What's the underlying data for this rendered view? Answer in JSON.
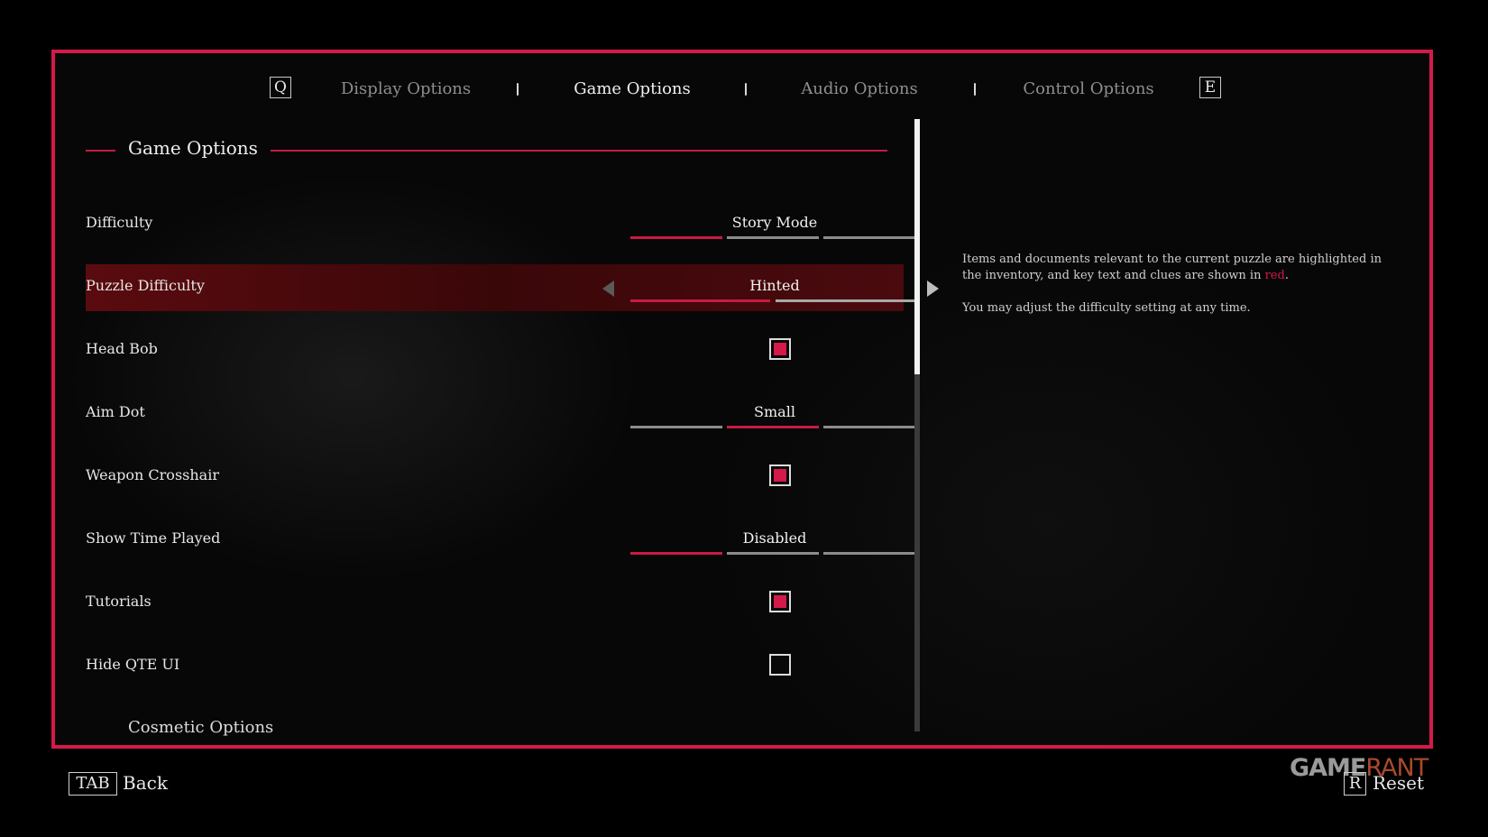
{
  "tabs": {
    "prev_key": "Q",
    "next_key": "E",
    "items": [
      {
        "label": "Display Options",
        "active": false
      },
      {
        "label": "Game Options",
        "active": true
      },
      {
        "label": "Audio Options",
        "active": false
      },
      {
        "label": "Control Options",
        "active": false
      }
    ]
  },
  "section": {
    "title": "Game Options",
    "next_section_title": "Cosmetic Options"
  },
  "settings": [
    {
      "label": "Difficulty",
      "type": "selector",
      "value": "Story Mode",
      "option_index": 1,
      "option_count": 3
    },
    {
      "label": "Puzzle Difficulty",
      "type": "selector",
      "value": "Hinted",
      "option_index": 1,
      "option_count": 2,
      "selected": true
    },
    {
      "label": "Head Bob",
      "type": "checkbox",
      "checked": true
    },
    {
      "label": "Aim Dot",
      "type": "selector",
      "value": "Small",
      "option_index": 2,
      "option_count": 3
    },
    {
      "label": "Weapon Crosshair",
      "type": "checkbox",
      "checked": true
    },
    {
      "label": "Show Time Played",
      "type": "selector",
      "value": "Disabled",
      "option_index": 1,
      "option_count": 3
    },
    {
      "label": "Tutorials",
      "type": "checkbox",
      "checked": true
    },
    {
      "label": "Hide QTE UI",
      "type": "checkbox",
      "checked": false
    }
  ],
  "description": {
    "line1_before": "Items and documents relevant to the current puzzle are highlighted in the inventory, and key text and clues are shown in ",
    "line1_red": "red",
    "line1_after": ".",
    "line2": "You may adjust the difficulty setting at any time."
  },
  "footer": {
    "back_key": "TAB",
    "back_label": "Back",
    "reset_key": "R",
    "reset_label": "Reset"
  },
  "watermark": {
    "part1": "GAME",
    "part2": "RANT"
  },
  "colors": {
    "accent": "#d31a4a",
    "selected_row": "#4a0a0e",
    "inactive_segment": "#8c8c8c"
  }
}
